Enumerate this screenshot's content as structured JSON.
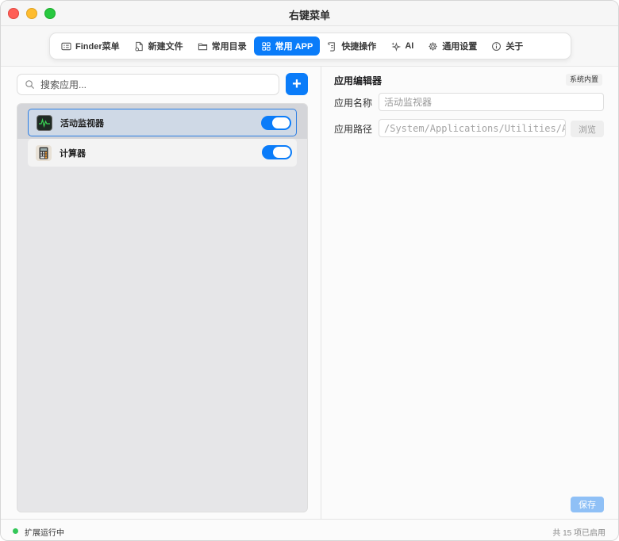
{
  "window": {
    "title": "右键菜单"
  },
  "tabs": [
    {
      "label": "Finder菜单",
      "icon": "finder-menu-icon",
      "active": false
    },
    {
      "label": "新建文件",
      "icon": "new-file-icon",
      "active": false
    },
    {
      "label": "常用目录",
      "icon": "folder-icon",
      "active": false
    },
    {
      "label": "常用 APP",
      "icon": "apps-grid-icon",
      "active": true
    },
    {
      "label": "快捷操作",
      "icon": "script-icon",
      "active": false
    },
    {
      "label": "AI",
      "icon": "sparkle-icon",
      "active": false
    },
    {
      "label": "通用设置",
      "icon": "gear-icon",
      "active": false
    },
    {
      "label": "关于",
      "icon": "info-icon",
      "active": false
    }
  ],
  "sidebar": {
    "search_placeholder": "搜索应用...",
    "add_label": "+",
    "apps": [
      {
        "name": "活动监视器",
        "enabled": true,
        "selected": true,
        "icon": "activity-monitor-icon"
      },
      {
        "name": "计算器",
        "enabled": true,
        "selected": false,
        "icon": "calculator-icon"
      }
    ]
  },
  "editor": {
    "title": "应用编辑器",
    "badge": "系统内置",
    "name_label": "应用名称",
    "name_placeholder": "活动监视器",
    "path_label": "应用路径",
    "path_value": "/System/Applications/Utilities/Activity Monitor.app",
    "browse_label": "浏览",
    "save_label": "保存"
  },
  "status": {
    "text": "扩展运行中",
    "count": "共 15 项已启用"
  },
  "colors": {
    "accent": "#0a7cf9",
    "status_ok": "#34c759"
  }
}
